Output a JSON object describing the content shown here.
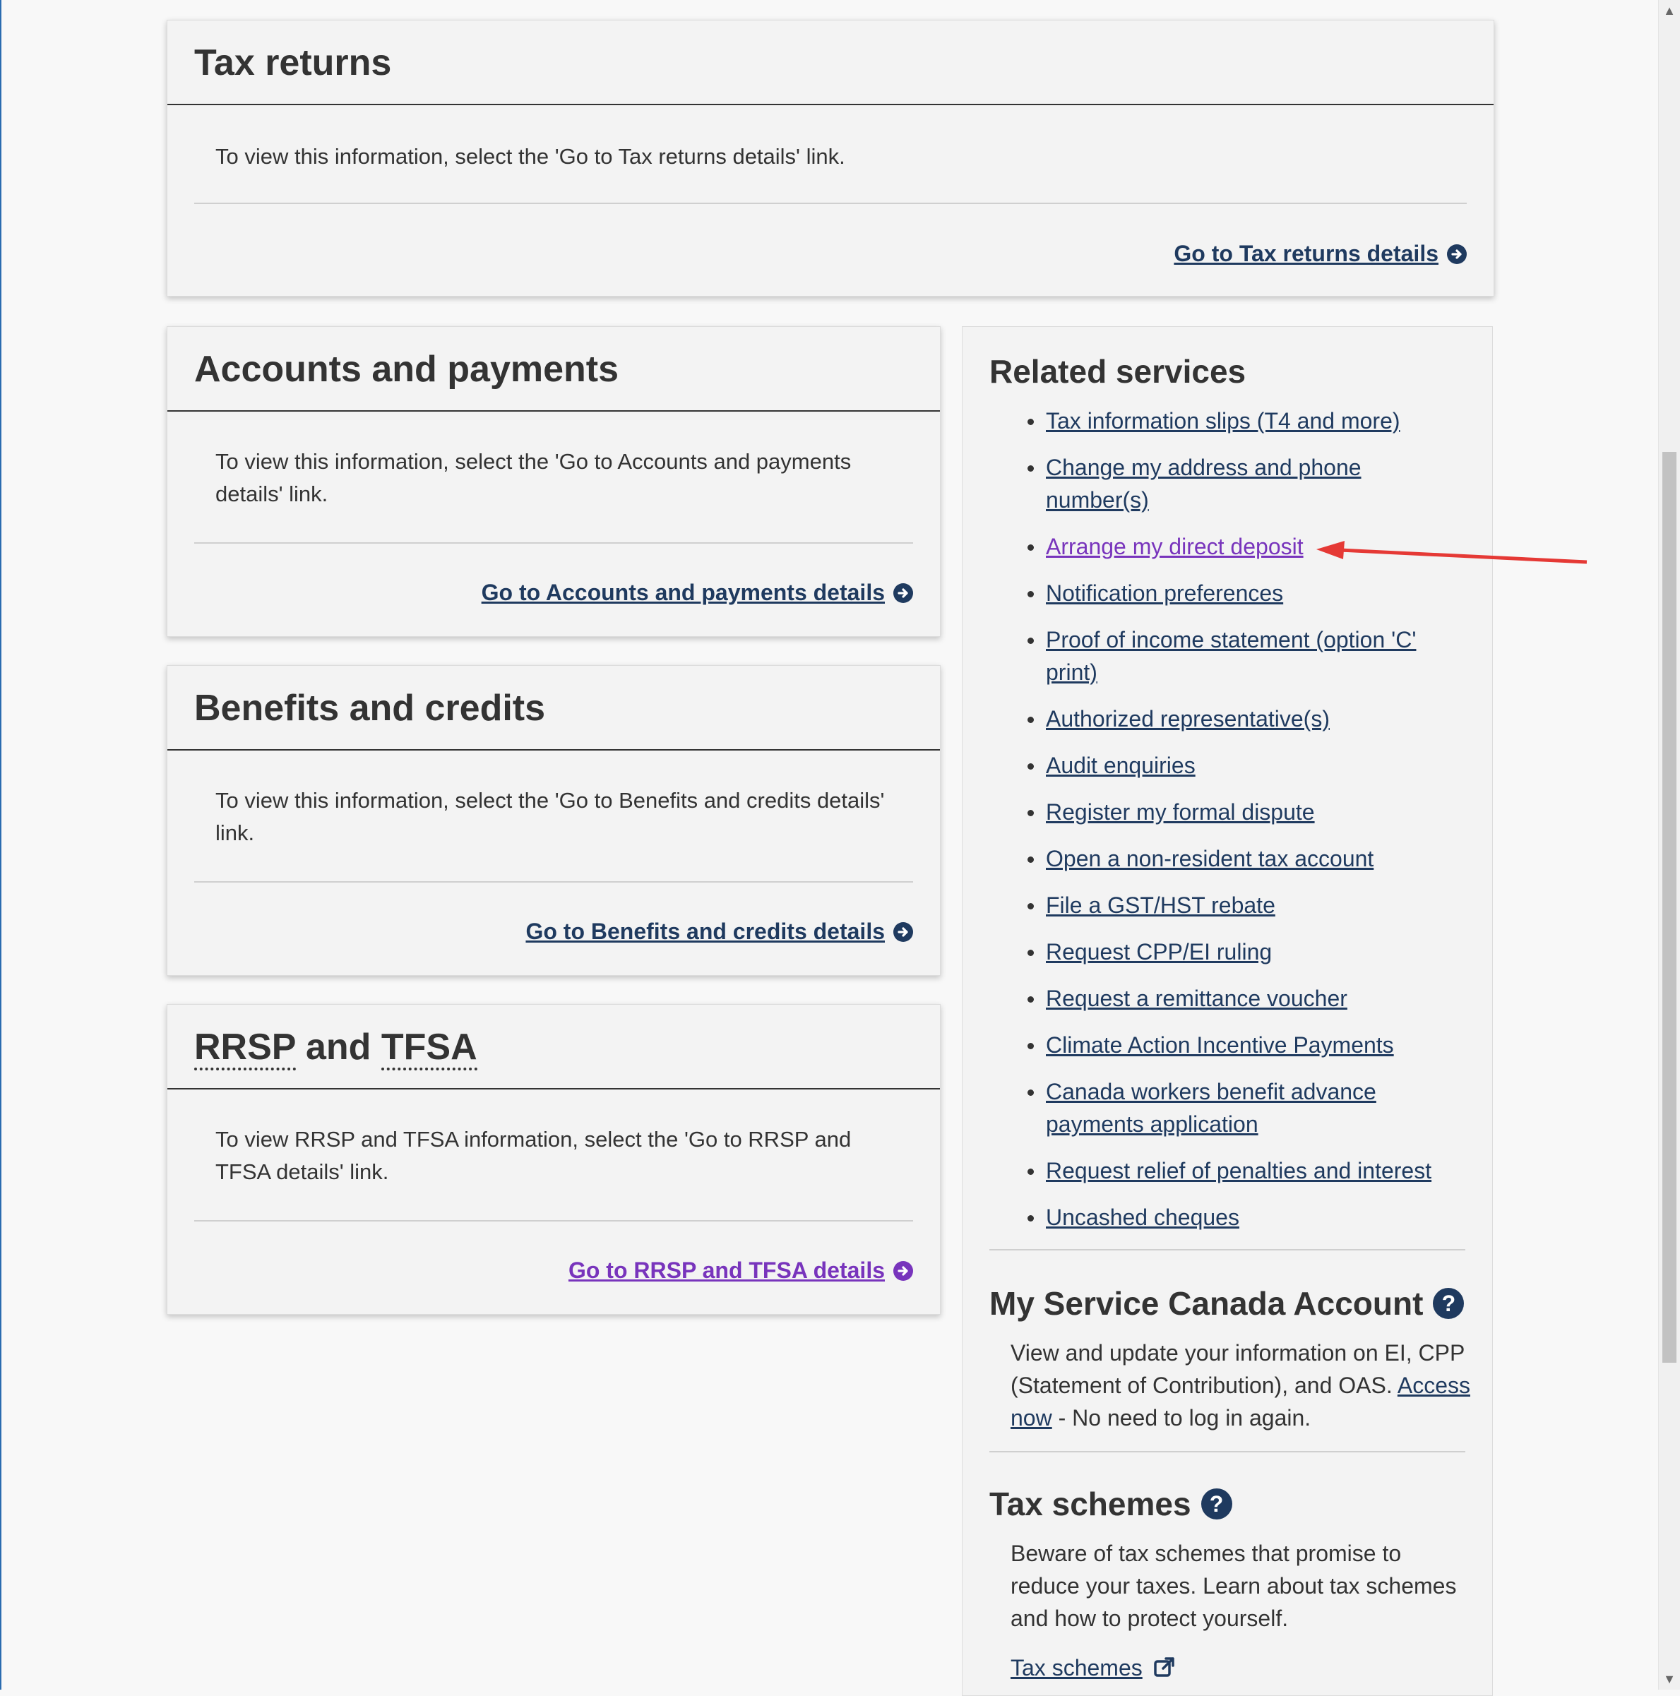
{
  "tax_returns": {
    "title": "Tax returns",
    "text": "To view this information, select the 'Go to Tax returns details' link.",
    "link": "Go to Tax returns details"
  },
  "accounts": {
    "title": "Accounts and payments",
    "text": "To view this information, select the 'Go to Accounts and payments details' link.",
    "link": "Go to Accounts and payments details"
  },
  "benefits": {
    "title": "Benefits and credits",
    "text": "To view this information, select the 'Go to Benefits and credits details' link.",
    "link": "Go to Benefits and credits details"
  },
  "rrsp": {
    "title_abbr1": "RRSP",
    "title_mid": "and",
    "title_abbr2": "TFSA",
    "text": "To view RRSP and TFSA information, select the 'Go to RRSP and TFSA details' link.",
    "link": "Go to RRSP and TFSA details"
  },
  "related": {
    "title": "Related services",
    "items": [
      {
        "label": "Tax information slips (T4 and more)"
      },
      {
        "label": "Change my address and phone number(s)"
      },
      {
        "label": "Arrange my direct deposit"
      },
      {
        "label": "Notification preferences"
      },
      {
        "label": "Proof of income statement (option 'C' print)"
      },
      {
        "label": "Authorized representative(s)"
      },
      {
        "label": "Audit enquiries"
      },
      {
        "label": "Register my formal dispute"
      },
      {
        "label": "Open a non-resident tax account"
      },
      {
        "label": "File a GST/HST rebate"
      },
      {
        "label": "Request CPP/EI ruling"
      },
      {
        "label": "Request a remittance voucher"
      },
      {
        "label": "Climate Action Incentive Payments"
      },
      {
        "label": "Canada workers benefit advance payments application"
      },
      {
        "label": "Request relief of penalties and interest"
      },
      {
        "label": "Uncashed cheques"
      }
    ]
  },
  "service_canada": {
    "title": "My Service Canada Account",
    "text": "View and update your information on EI, CPP (Statement of Contribution), and OAS.",
    "link": "Access now",
    "after_link": " -  No need to log in again."
  },
  "tax_schemes": {
    "title": "Tax schemes",
    "text": "Beware of tax schemes that promise to reduce your taxes. Learn about tax schemes and how to protect yourself.",
    "link": "Tax schemes"
  },
  "colors": {
    "link": "#1f3a5f",
    "visited_link": "#7834bc",
    "annotation_arrow": "#e53935"
  }
}
